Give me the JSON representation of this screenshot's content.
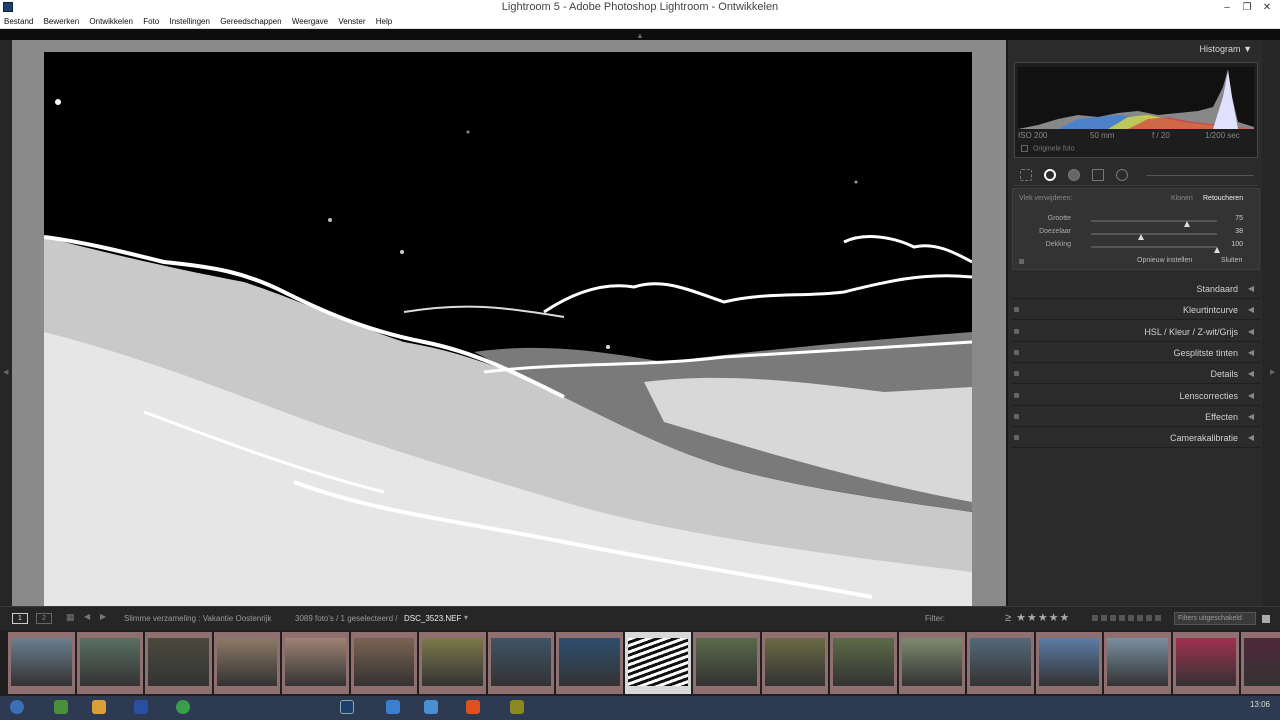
{
  "window": {
    "title": "Lightroom 5 - Adobe Photoshop Lightroom - Ontwikkelen",
    "minimize": "–",
    "maximize": "❐",
    "close": "✕"
  },
  "menu": [
    "Bestand",
    "Bewerken",
    "Ontwikkelen",
    "Foto",
    "Instellingen",
    "Gereedschappen",
    "Weergave",
    "Venster",
    "Help"
  ],
  "histogram": {
    "title": "Histogram",
    "iso": "ISO 200",
    "focal": "50 mm",
    "aperture": "f / 20",
    "shutter": "1/200 sec",
    "original_photo": "Originele foto"
  },
  "spot_removal": {
    "header_left": "Vlek verwijderen:",
    "clone": "Klonen",
    "heal": "Retoucheren",
    "sliders": [
      {
        "label": "Grootte",
        "value": "75",
        "fraction": 0.76
      },
      {
        "label": "Doezelaar",
        "value": "38",
        "fraction": 0.4
      },
      {
        "label": "Dekking",
        "value": "100",
        "fraction": 1.0
      }
    ],
    "reset": "Opnieuw instellen",
    "close": "Sluiten"
  },
  "sections": [
    {
      "name": "Standaard",
      "switch": false
    },
    {
      "name": "Kleurtintcurve",
      "switch": true
    },
    {
      "name": "HSL  /  Kleur  /  Z-wit/Grijs",
      "switch": true
    },
    {
      "name": "Gesplitste tinten",
      "switch": true
    },
    {
      "name": "Details",
      "switch": true
    },
    {
      "name": "Lenscorrecties",
      "switch": true
    },
    {
      "name": "Effecten",
      "switch": true
    },
    {
      "name": "Camerakalibratie",
      "switch": true
    }
  ],
  "filmstrip": {
    "page1": "1",
    "page2": "2",
    "source": "Slimme verzameling : Vakantie Oostenrijk",
    "count": "3089 foto's / 1 geselecteerd /",
    "filename": "DSC_3523.NEF",
    "filter_label": "Filter:",
    "filters_off": "Filters uitgeschakeld"
  },
  "thumbnails": [
    {
      "color": "#6b7f8f"
    },
    {
      "color": "#5a6f63"
    },
    {
      "color": "#4a4a3e"
    },
    {
      "color": "#8d7a66"
    },
    {
      "color": "#a08374"
    },
    {
      "color": "#7a6352"
    },
    {
      "color": "#7c7a4a"
    },
    {
      "color": "#3f5466"
    },
    {
      "color": "#2f4f6f"
    },
    {
      "color": "#f0f0f0",
      "selected": true
    },
    {
      "color": "#5a6a4a"
    },
    {
      "color": "#6a6a44"
    },
    {
      "color": "#5d6b47"
    },
    {
      "color": "#7d8a6e"
    },
    {
      "color": "#55697a"
    },
    {
      "color": "#5b7da6"
    },
    {
      "color": "#7a8fa0"
    },
    {
      "color": "#a03050"
    },
    {
      "color": "#502838"
    }
  ],
  "taskbar": {
    "clock": "13:06"
  }
}
